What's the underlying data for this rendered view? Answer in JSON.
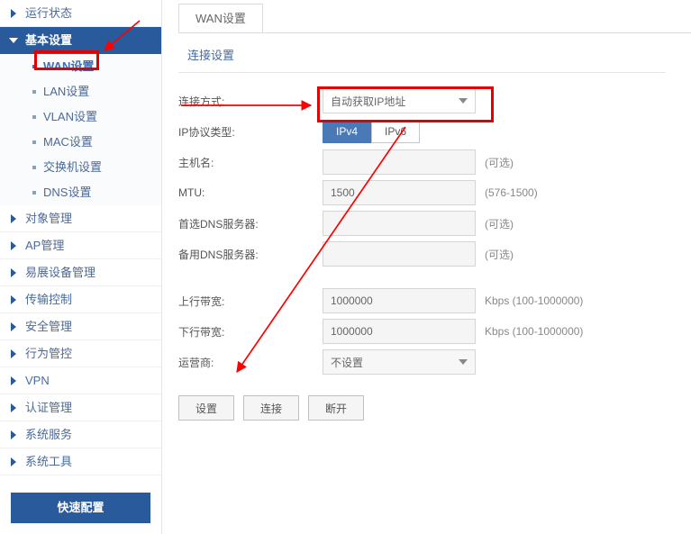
{
  "sidebar": {
    "items": [
      {
        "label": "运行状态",
        "type": "collapsed"
      },
      {
        "label": "基本设置",
        "type": "expanded"
      },
      {
        "label": "对象管理",
        "type": "collapsed"
      },
      {
        "label": "AP管理",
        "type": "collapsed"
      },
      {
        "label": "易展设备管理",
        "type": "collapsed"
      },
      {
        "label": "传输控制",
        "type": "collapsed"
      },
      {
        "label": "安全管理",
        "type": "collapsed"
      },
      {
        "label": "行为管控",
        "type": "collapsed"
      },
      {
        "label": "VPN",
        "type": "collapsed"
      },
      {
        "label": "认证管理",
        "type": "collapsed"
      },
      {
        "label": "系统服务",
        "type": "collapsed"
      },
      {
        "label": "系统工具",
        "type": "collapsed"
      }
    ],
    "sub_items": [
      {
        "label": "WAN设置",
        "active": true
      },
      {
        "label": "LAN设置",
        "active": false
      },
      {
        "label": "VLAN设置",
        "active": false
      },
      {
        "label": "MAC设置",
        "active": false
      },
      {
        "label": "交换机设置",
        "active": false
      },
      {
        "label": "DNS设置",
        "active": false
      }
    ],
    "quick_config": "快速配置"
  },
  "tab": {
    "label": "WAN设置"
  },
  "section_title": "连接设置",
  "form": {
    "conn_mode": {
      "label": "连接方式:",
      "value": "自动获取IP地址"
    },
    "ip_proto": {
      "label": "IP协议类型:",
      "opt1": "IPv4",
      "opt2": "IPv6"
    },
    "hostname": {
      "label": "主机名:",
      "value": "",
      "hint": "(可选)"
    },
    "mtu": {
      "label": "MTU:",
      "value": "1500",
      "hint": "(576-1500)"
    },
    "dns1": {
      "label": "首选DNS服务器:",
      "value": "",
      "hint": "(可选)"
    },
    "dns2": {
      "label": "备用DNS服务器:",
      "value": "",
      "hint": "(可选)"
    },
    "up_bw": {
      "label": "上行带宽:",
      "value": "1000000",
      "hint": "Kbps (100-1000000)"
    },
    "down_bw": {
      "label": "下行带宽:",
      "value": "1000000",
      "hint": "Kbps (100-1000000)"
    },
    "isp": {
      "label": "运营商:",
      "value": "不设置"
    }
  },
  "buttons": {
    "apply": "设置",
    "connect": "连接",
    "disconnect": "断开"
  },
  "annotation_colors": {
    "highlight": "#e20000",
    "arrow": "#ff0000"
  }
}
